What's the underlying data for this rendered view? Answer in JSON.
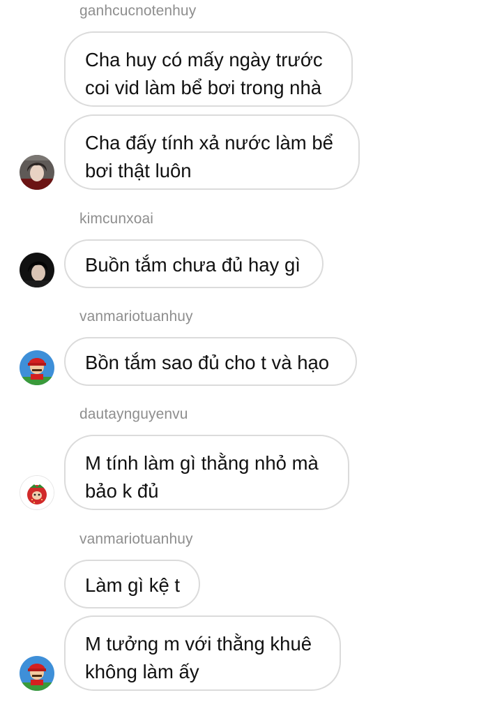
{
  "messages": [
    {
      "sender": "ganhcucnotenhuy",
      "bubbles": [
        [
          "Cha huy có mấy ngày trước",
          "coi vid làm bể bơi trong nhà"
        ],
        [
          "Cha đấy tính xả nước làm bể",
          "bơi thật luôn"
        ]
      ],
      "avatar_icon": "person-dark-hair-icon"
    },
    {
      "sender": "kimcunxoai",
      "bubbles": [
        [
          "Buồn tắm chưa đủ hay gì"
        ]
      ],
      "avatar_icon": "person-black-hair-icon"
    },
    {
      "sender": "vanmariotuanhuy",
      "bubbles": [
        [
          "Bồn tắm sao đủ cho t và hạo"
        ]
      ],
      "avatar_icon": "mario-icon"
    },
    {
      "sender": "dautaynguyenvu",
      "bubbles": [
        [
          "M tính làm gì thằng nhỏ mà",
          "bảo k đủ"
        ]
      ],
      "avatar_icon": "strawberry-character-icon"
    },
    {
      "sender": "vanmariotuanhuy",
      "bubbles": [
        [
          "Làm gì kệ t"
        ],
        [
          "M tưởng m với thằng khuê",
          "không làm ấy"
        ]
      ],
      "avatar_icon": "mario-icon"
    }
  ]
}
